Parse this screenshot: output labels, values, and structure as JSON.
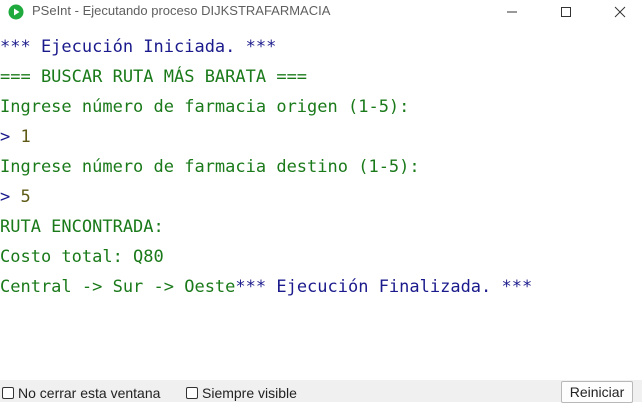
{
  "window": {
    "title": "PSeInt - Ejecutando proceso DIJKSTRAFARMACIA",
    "icon": "pseint-play-icon"
  },
  "colors": {
    "system_text": "#1a1a8c",
    "program_output": "#1a7a1a",
    "user_input": "#5e5a16"
  },
  "console": {
    "lines": [
      {
        "text": "*** Ejecución Iniciada. ***",
        "kind": "system"
      },
      {
        "text": "=== BUSCAR RUTA MÁS BARATA ===",
        "kind": "output"
      },
      {
        "text": "Ingrese número de farmacia origen (1-5):",
        "kind": "output"
      },
      {
        "prompt": "> ",
        "value": "1",
        "kind": "input"
      },
      {
        "text": "Ingrese número de farmacia destino (1-5):",
        "kind": "output"
      },
      {
        "prompt": "> ",
        "value": "5",
        "kind": "input"
      },
      {
        "text": "RUTA ENCONTRADA:",
        "kind": "output"
      },
      {
        "text": "Costo total: Q80",
        "kind": "output"
      },
      {
        "text": "Central -> Sur -> Oeste",
        "kind": "output",
        "suffix": "*** Ejecución Finalizada. ***"
      }
    ]
  },
  "statusbar": {
    "keep_open_label": "No cerrar esta ventana",
    "always_visible_label": "Siempre visible",
    "restart_label": "Reiniciar"
  }
}
